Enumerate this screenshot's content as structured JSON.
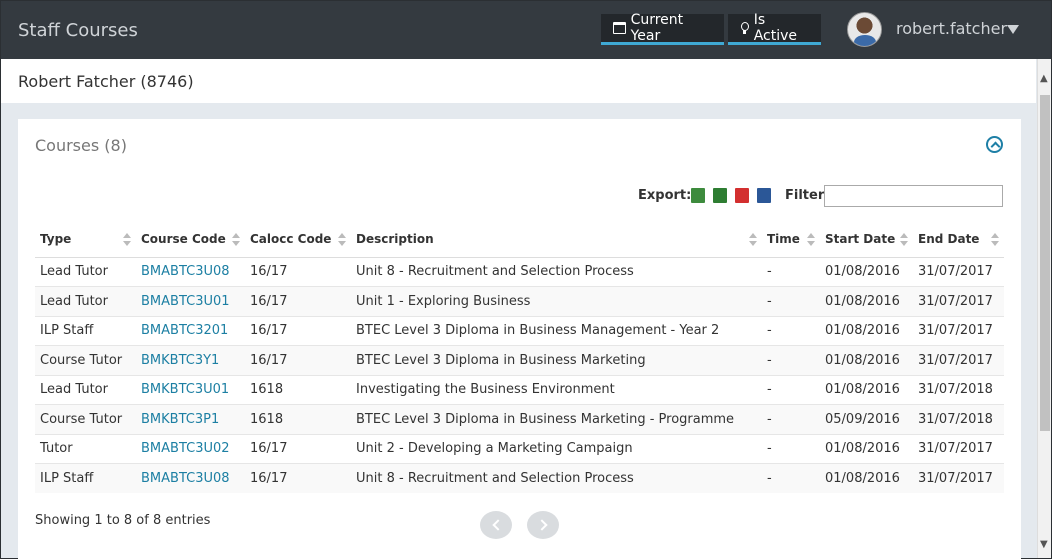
{
  "app": {
    "title": "Staff Courses"
  },
  "header": {
    "current_year_label": "Current Year",
    "is_active_label": "Is Active",
    "username": "robert.fatcher"
  },
  "person": {
    "name": "Robert Fatcher (8746)"
  },
  "panel": {
    "title": "Courses (8)",
    "export_label": "Export:",
    "filter_label": "Filter:",
    "filter_value": ""
  },
  "table": {
    "columns": [
      "Type",
      "Course Code",
      "Calocc Code",
      "Description",
      "Time",
      "Start Date",
      "End Date"
    ],
    "rows": [
      [
        "Lead Tutor",
        "BMABTC3U08",
        "16/17",
        "Unit 8 - Recruitment and Selection Process",
        "-",
        "01/08/2016",
        "31/07/2017"
      ],
      [
        "Lead Tutor",
        "BMABTC3U01",
        "16/17",
        "Unit 1 - Exploring Business",
        "-",
        "01/08/2016",
        "31/07/2017"
      ],
      [
        "ILP Staff",
        "BMABTC3201",
        "16/17",
        "BTEC Level 3 Diploma in Business Management - Year 2",
        "-",
        "01/08/2016",
        "31/07/2017"
      ],
      [
        "Course Tutor",
        "BMKBTC3Y1",
        "16/17",
        "BTEC Level 3 Diploma in Business Marketing",
        "-",
        "01/08/2016",
        "31/07/2017"
      ],
      [
        "Lead Tutor",
        "BMKBTC3U01",
        "1618",
        "Investigating the Business Environment",
        "-",
        "01/08/2016",
        "31/07/2018"
      ],
      [
        "Course Tutor",
        "BMKBTC3P1",
        "1618",
        "BTEC Level 3 Diploma in Business Marketing - Programme",
        "-",
        "05/09/2016",
        "31/07/2018"
      ],
      [
        "Tutor",
        "BMABTC3U02",
        "16/17",
        "Unit 2 - Developing a Marketing Campaign",
        "-",
        "01/08/2016",
        "31/07/2017"
      ],
      [
        "ILP Staff",
        "BMABTC3U08",
        "16/17",
        "Unit 8 - Recruitment and Selection Process",
        "-",
        "01/08/2016",
        "31/07/2017"
      ]
    ]
  },
  "footer": {
    "showing_text": "Showing 1 to 8 of 8 entries"
  },
  "colors": {
    "accent": "#3fa9d4",
    "link": "#1c7fa3",
    "header_bg": "#343a40"
  }
}
